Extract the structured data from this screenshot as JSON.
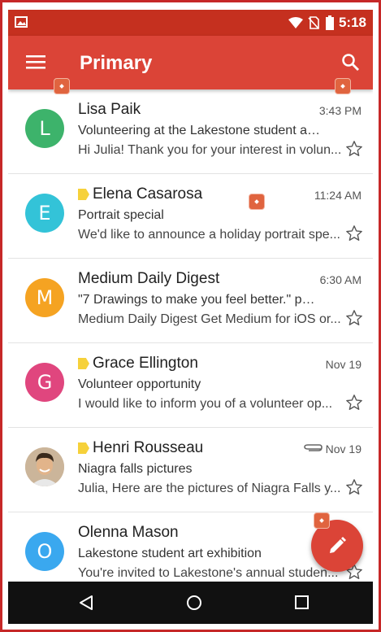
{
  "status_bar": {
    "time": "5:18"
  },
  "app_bar": {
    "title": "Primary"
  },
  "emails": [
    {
      "avatar_letter": "L",
      "avatar_color": "#3db36b",
      "sender": "Lisa Paik",
      "important": false,
      "time": "3:43 PM",
      "subject": "Volunteering at the Lakestone student art...",
      "snippet": "Hi Julia! Thank you for your interest in volun...",
      "attachment": false
    },
    {
      "avatar_letter": "E",
      "avatar_color": "#33c3d8",
      "sender": "Elena Casarosa",
      "important": true,
      "time": "11:24 AM",
      "subject": "Portrait special",
      "snippet": "We'd like to announce a holiday portrait spe...",
      "attachment": false
    },
    {
      "avatar_letter": "M",
      "avatar_color": "#f5a322",
      "sender": "Medium Daily Digest",
      "important": false,
      "time": "6:30 AM",
      "subject": "\"7 Drawings to make you feel better.\" publi...",
      "snippet": "Medium Daily Digest Get Medium for iOS or...",
      "attachment": false
    },
    {
      "avatar_letter": "G",
      "avatar_color": "#e0467e",
      "sender": "Grace Ellington",
      "important": true,
      "time": "Nov 19",
      "subject": "Volunteer opportunity",
      "snippet": "I would like to inform you of a volunteer op...",
      "attachment": false
    },
    {
      "avatar_letter": "",
      "avatar_color": "#d9c2a6",
      "sender": "Henri Rousseau",
      "important": true,
      "time": "Nov 19",
      "subject": "Niagra falls pictures",
      "snippet": "Julia, Here are the pictures of Niagra Falls y...",
      "attachment": true
    },
    {
      "avatar_letter": "O",
      "avatar_color": "#3aa8ef",
      "sender": "Olenna Mason",
      "important": false,
      "time": "",
      "subject": "Lakestone student art exhibition",
      "snippet": "You're invited to Lakestone's annual studen...",
      "attachment": false
    }
  ],
  "icons": {
    "menu": "menu-icon",
    "search": "search-icon",
    "star": "star-outline-icon",
    "attachment": "paperclip-icon",
    "compose": "pencil-icon",
    "back": "back-triangle-icon",
    "home": "home-circle-icon",
    "recents": "recents-square-icon"
  },
  "colors": {
    "status_bar": "#c5301f",
    "app_bar": "#db4437",
    "fab": "#db4437",
    "important_tag": "#f6d13a"
  }
}
